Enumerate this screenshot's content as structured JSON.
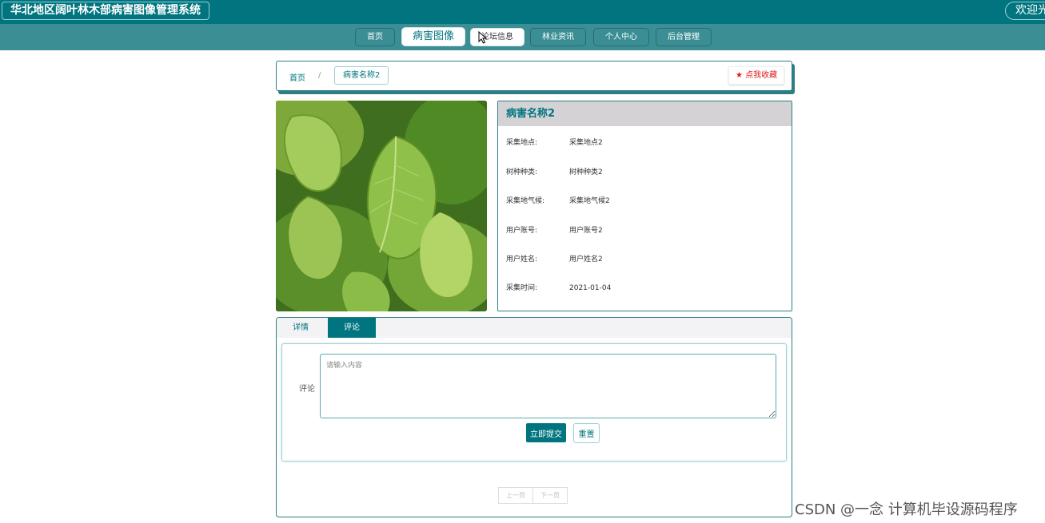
{
  "header": {
    "site_title": "华北地区阔叶林木部病害图像管理系统",
    "welcome": "欢迎光"
  },
  "nav": {
    "items": [
      {
        "label": "首页"
      },
      {
        "label": "病害图像"
      },
      {
        "label": "论坛信息"
      },
      {
        "label": "林业资讯"
      },
      {
        "label": "个人中心"
      },
      {
        "label": "后台管理"
      }
    ]
  },
  "breadcrumb": {
    "home": "首页",
    "separator": "/",
    "current": "病害名称2",
    "favorite": "点我收藏"
  },
  "detail": {
    "title": "病害名称2",
    "fields": [
      {
        "label": "采集地点:",
        "value": "采集地点2"
      },
      {
        "label": "树种种类:",
        "value": "树种种类2"
      },
      {
        "label": "采集地气候:",
        "value": "采集地气候2"
      },
      {
        "label": "用户账号:",
        "value": "用户账号2"
      },
      {
        "label": "用户姓名:",
        "value": "用户姓名2"
      },
      {
        "label": "采集时间:",
        "value": "2021-01-04"
      }
    ]
  },
  "tabs": {
    "items": [
      {
        "label": "详情"
      },
      {
        "label": "评论"
      }
    ],
    "active": "评论"
  },
  "comment_form": {
    "label": "评论",
    "placeholder": "请输入内容",
    "value": "",
    "submit": "立即提交",
    "reset": "重置"
  },
  "pager": {
    "prev": "上一页",
    "next": "下一页"
  },
  "watermark": "CSDN @一念 计算机毕设源码程序",
  "colors": {
    "primary": "#00757f",
    "nav_bg": "#3a8e94",
    "favorite_red": "#e01b1b"
  }
}
